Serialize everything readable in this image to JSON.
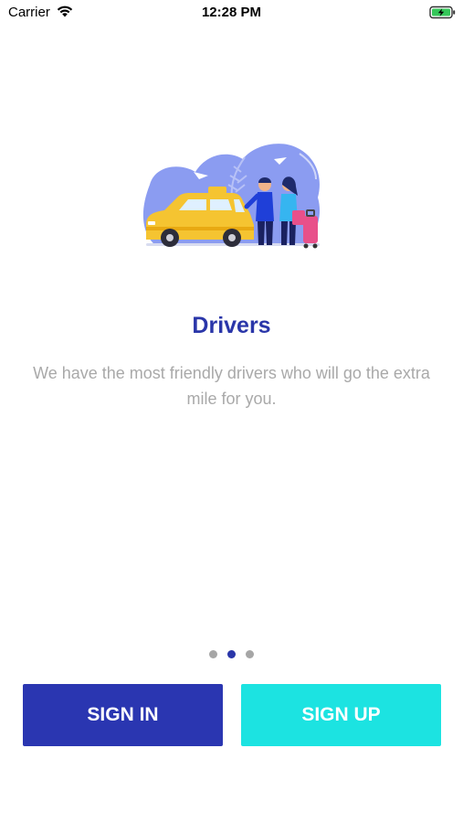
{
  "status_bar": {
    "carrier": "Carrier",
    "time": "12:28 PM"
  },
  "onboarding": {
    "illustration_icon": "taxi-drivers-illustration",
    "title": "Drivers",
    "subtitle": "We have the most friendly drivers who will go the extra mile for you.",
    "page_count": 3,
    "active_page_index": 1
  },
  "actions": {
    "sign_in_label": "SIGN IN",
    "sign_up_label": "SIGN UP"
  },
  "colors": {
    "primary": "#2a36b1",
    "accent": "#1ce3e1",
    "muted_text": "#a9a9a9"
  }
}
